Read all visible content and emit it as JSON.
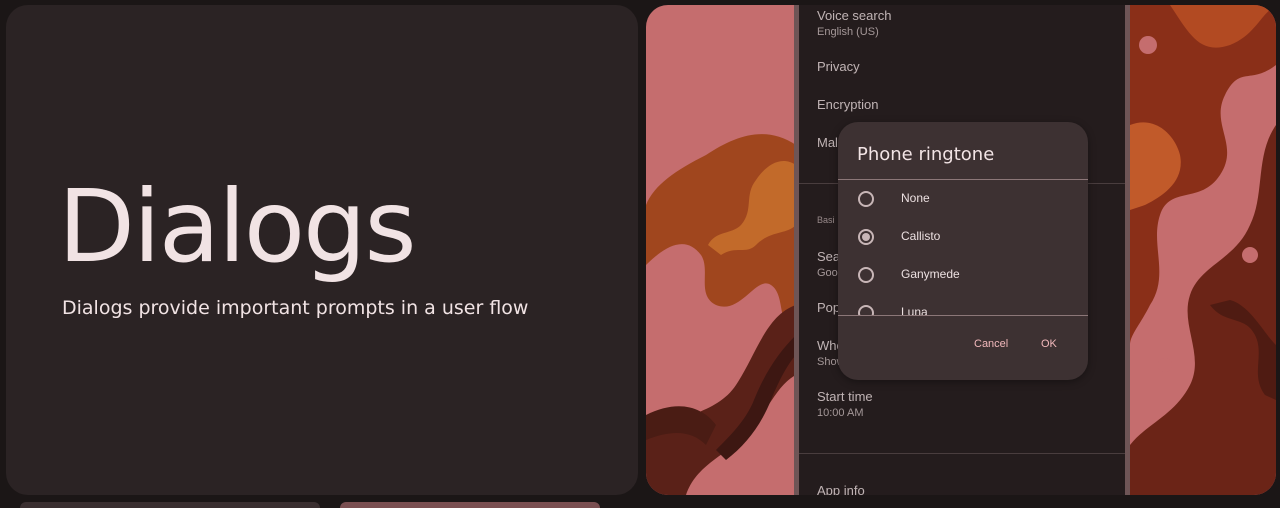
{
  "hero": {
    "title": "Dialogs",
    "subtitle": "Dialogs provide important prompts in a user flow"
  },
  "settings": {
    "voice_search": {
      "title": "Voice search",
      "subtitle": "English (US)"
    },
    "privacy": {
      "title": "Privacy"
    },
    "encryption": {
      "title": "Encryption"
    },
    "mal_partial": "Mal",
    "basic_partial": "Basi",
    "sea_partial": {
      "title": "Sea",
      "subtitle": "Goo"
    },
    "pop_partial": "Pop",
    "whe_partial": {
      "title": "Whe",
      "subtitle": "Show"
    },
    "start_time": {
      "title": "Start time",
      "subtitle": "10:00 AM"
    },
    "app_info": {
      "title": "App info"
    }
  },
  "dialog": {
    "title": "Phone ringtone",
    "options": [
      {
        "label": "None",
        "selected": false
      },
      {
        "label": "Callisto",
        "selected": true
      },
      {
        "label": "Ganymede",
        "selected": false
      },
      {
        "label": "Luna",
        "selected": false
      }
    ],
    "cancel_label": "Cancel",
    "ok_label": "OK"
  },
  "colors": {
    "background": "#1b1616",
    "card": "#2b2324",
    "accent_pink": "#c56d6e",
    "dialog_surface": "#3d3132",
    "button_text": "#f1b8bb"
  }
}
